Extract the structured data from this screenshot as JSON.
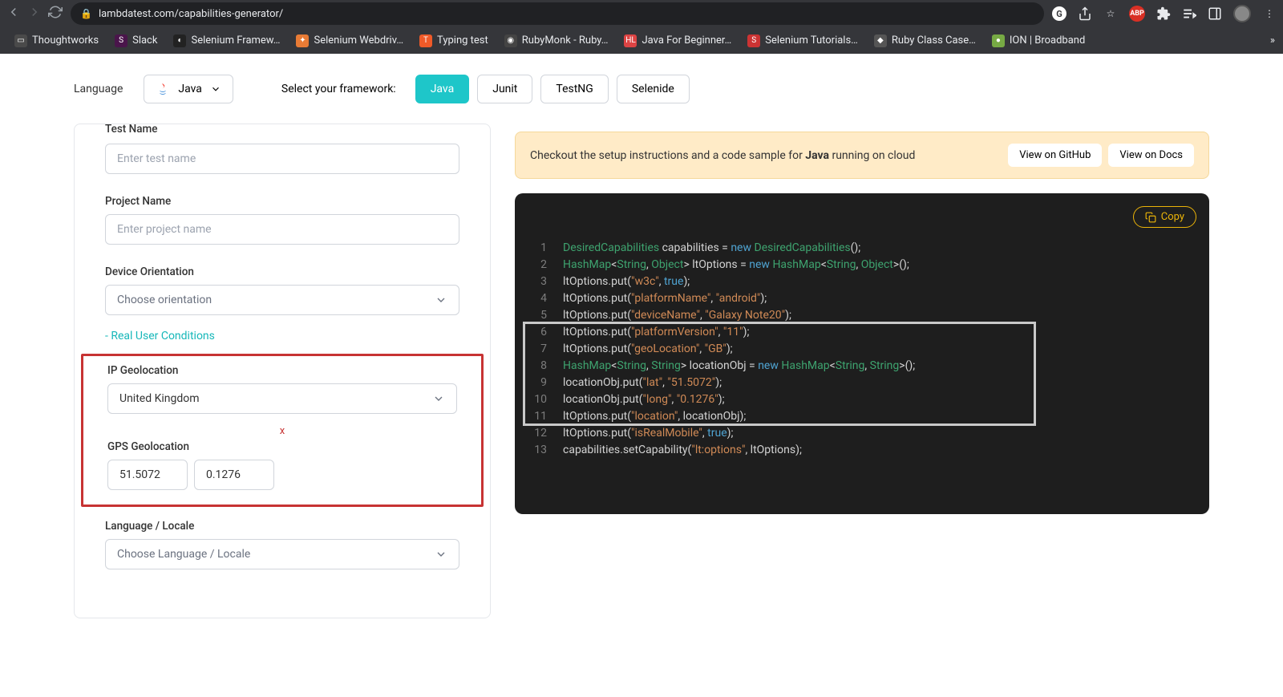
{
  "browser": {
    "url": "lambdatest.com/capabilities-generator/",
    "bookmarks": [
      {
        "label": "Thoughtworks",
        "color": "#4a4a4a",
        "ic": "▭"
      },
      {
        "label": "Slack",
        "color": "#4a154b",
        "ic": "S"
      },
      {
        "label": "Selenium Framew…",
        "color": "#222",
        "ic": "◐"
      },
      {
        "label": "Selenium Webdriv…",
        "color": "#e87b35",
        "ic": "✦"
      },
      {
        "label": "Typing test",
        "color": "#f05a28",
        "ic": "T"
      },
      {
        "label": "RubyMonk - Ruby…",
        "color": "#444",
        "ic": "◉"
      },
      {
        "label": "Java For Beginner…",
        "color": "#d44",
        "ic": "HL"
      },
      {
        "label": "Selenium Tutorials…",
        "color": "#c33",
        "ic": "S"
      },
      {
        "label": "Ruby Class Case…",
        "color": "#555",
        "ic": "◆"
      },
      {
        "label": "ION | Broadband",
        "color": "#7a4",
        "ic": "●"
      }
    ]
  },
  "toolbar": {
    "language_label": "Language",
    "language_value": "Java",
    "select_framework_label": "Select your framework:",
    "frameworks": [
      {
        "label": "Java",
        "active": true
      },
      {
        "label": "Junit",
        "active": false
      },
      {
        "label": "TestNG",
        "active": false
      },
      {
        "label": "Selenide",
        "active": false
      }
    ]
  },
  "form": {
    "test_name_label": "Test Name",
    "test_name_placeholder": "Enter test name",
    "project_name_label": "Project Name",
    "project_name_placeholder": "Enter project name",
    "device_orientation_label": "Device Orientation",
    "device_orientation_placeholder": "Choose orientation",
    "real_user_conditions": "- Real User Conditions",
    "ip_geo_label": "IP Geolocation",
    "ip_geo_value": "United Kingdom",
    "clear_x": "x",
    "gps_geo_label": "GPS Geolocation",
    "gps_lat": "51.5072",
    "gps_long": "0.1276",
    "lang_locale_label": "Language / Locale",
    "lang_locale_placeholder": "Choose Language / Locale"
  },
  "banner": {
    "text_pre": "Checkout the setup instructions and a code sample for ",
    "text_bold": "Java",
    "text_post": " running on cloud",
    "btn_github": "View on GitHub",
    "btn_docs": "View on Docs"
  },
  "code": {
    "copy": "Copy",
    "lines": [
      {
        "n": 1,
        "segs": [
          {
            "c": "tk-type",
            "t": "DesiredCapabilities"
          },
          {
            "c": "tk-ident",
            "t": " capabilities = "
          },
          {
            "c": "tk-new",
            "t": "new"
          },
          {
            "c": "tk-ident",
            "t": " "
          },
          {
            "c": "tk-type",
            "t": "DesiredCapabilities"
          },
          {
            "c": "tk-punct",
            "t": "();"
          }
        ]
      },
      {
        "n": 2,
        "segs": [
          {
            "c": "tk-type",
            "t": "HashMap"
          },
          {
            "c": "tk-punct",
            "t": "<"
          },
          {
            "c": "tk-type",
            "t": "String"
          },
          {
            "c": "tk-punct",
            "t": ", "
          },
          {
            "c": "tk-type",
            "t": "Object"
          },
          {
            "c": "tk-punct",
            "t": "> ltOptions = "
          },
          {
            "c": "tk-new",
            "t": "new"
          },
          {
            "c": "tk-punct",
            "t": " "
          },
          {
            "c": "tk-type",
            "t": "HashMap"
          },
          {
            "c": "tk-punct",
            "t": "<"
          },
          {
            "c": "tk-type",
            "t": "String"
          },
          {
            "c": "tk-punct",
            "t": ", "
          },
          {
            "c": "tk-type",
            "t": "Object"
          },
          {
            "c": "tk-punct",
            "t": ">();"
          }
        ]
      },
      {
        "n": 3,
        "segs": [
          {
            "c": "tk-ident",
            "t": "ltOptions.put("
          },
          {
            "c": "tk-str",
            "t": "\"w3c\""
          },
          {
            "c": "tk-punct",
            "t": ", "
          },
          {
            "c": "tk-bool",
            "t": "true"
          },
          {
            "c": "tk-punct",
            "t": ");"
          }
        ]
      },
      {
        "n": 4,
        "segs": [
          {
            "c": "tk-ident",
            "t": "ltOptions.put("
          },
          {
            "c": "tk-str",
            "t": "\"platformName\""
          },
          {
            "c": "tk-punct",
            "t": ", "
          },
          {
            "c": "tk-str",
            "t": "\"android\""
          },
          {
            "c": "tk-punct",
            "t": ");"
          }
        ]
      },
      {
        "n": 5,
        "segs": [
          {
            "c": "tk-ident",
            "t": "ltOptions.put("
          },
          {
            "c": "tk-str",
            "t": "\"deviceName\""
          },
          {
            "c": "tk-punct",
            "t": ", "
          },
          {
            "c": "tk-str",
            "t": "\"Galaxy Note20\""
          },
          {
            "c": "tk-punct",
            "t": ");"
          }
        ]
      },
      {
        "n": 6,
        "segs": [
          {
            "c": "tk-ident",
            "t": "ltOptions.put("
          },
          {
            "c": "tk-str",
            "t": "\"platformVersion\""
          },
          {
            "c": "tk-punct",
            "t": ", "
          },
          {
            "c": "tk-str",
            "t": "\"11\""
          },
          {
            "c": "tk-punct",
            "t": ");"
          }
        ]
      },
      {
        "n": 7,
        "segs": [
          {
            "c": "tk-ident",
            "t": "ltOptions.put("
          },
          {
            "c": "tk-str",
            "t": "\"geoLocation\""
          },
          {
            "c": "tk-punct",
            "t": ", "
          },
          {
            "c": "tk-str",
            "t": "\"GB\""
          },
          {
            "c": "tk-punct",
            "t": ");"
          }
        ]
      },
      {
        "n": 8,
        "segs": [
          {
            "c": "tk-type",
            "t": "HashMap"
          },
          {
            "c": "tk-punct",
            "t": "<"
          },
          {
            "c": "tk-type",
            "t": "String"
          },
          {
            "c": "tk-punct",
            "t": ", "
          },
          {
            "c": "tk-type",
            "t": "String"
          },
          {
            "c": "tk-punct",
            "t": "> locationObj = "
          },
          {
            "c": "tk-new",
            "t": "new"
          },
          {
            "c": "tk-punct",
            "t": " "
          },
          {
            "c": "tk-type",
            "t": "HashMap"
          },
          {
            "c": "tk-punct",
            "t": "<"
          },
          {
            "c": "tk-type",
            "t": "String"
          },
          {
            "c": "tk-punct",
            "t": ", "
          },
          {
            "c": "tk-type",
            "t": "String"
          },
          {
            "c": "tk-punct",
            "t": ">();"
          }
        ]
      },
      {
        "n": 9,
        "segs": [
          {
            "c": "tk-ident",
            "t": "locationObj.put("
          },
          {
            "c": "tk-str",
            "t": "\"lat\""
          },
          {
            "c": "tk-punct",
            "t": ", "
          },
          {
            "c": "tk-str",
            "t": "\"51.5072\""
          },
          {
            "c": "tk-punct",
            "t": ");"
          }
        ]
      },
      {
        "n": 10,
        "segs": [
          {
            "c": "tk-ident",
            "t": "locationObj.put("
          },
          {
            "c": "tk-str",
            "t": "\"long\""
          },
          {
            "c": "tk-punct",
            "t": ", "
          },
          {
            "c": "tk-str",
            "t": "\"0.1276\""
          },
          {
            "c": "tk-punct",
            "t": ");"
          }
        ]
      },
      {
        "n": 11,
        "segs": [
          {
            "c": "tk-ident",
            "t": "ltOptions.put("
          },
          {
            "c": "tk-str",
            "t": "\"location\""
          },
          {
            "c": "tk-punct",
            "t": ", locationObj);"
          }
        ]
      },
      {
        "n": 12,
        "segs": [
          {
            "c": "tk-ident",
            "t": "ltOptions.put("
          },
          {
            "c": "tk-str",
            "t": "\"isRealMobile\""
          },
          {
            "c": "tk-punct",
            "t": ", "
          },
          {
            "c": "tk-bool",
            "t": "true"
          },
          {
            "c": "tk-punct",
            "t": ");"
          }
        ]
      },
      {
        "n": 13,
        "segs": [
          {
            "c": "tk-ident",
            "t": "capabilities.setCapability("
          },
          {
            "c": "tk-str",
            "t": "\"lt:options\""
          },
          {
            "c": "tk-punct",
            "t": ", ltOptions);"
          }
        ]
      }
    ]
  }
}
